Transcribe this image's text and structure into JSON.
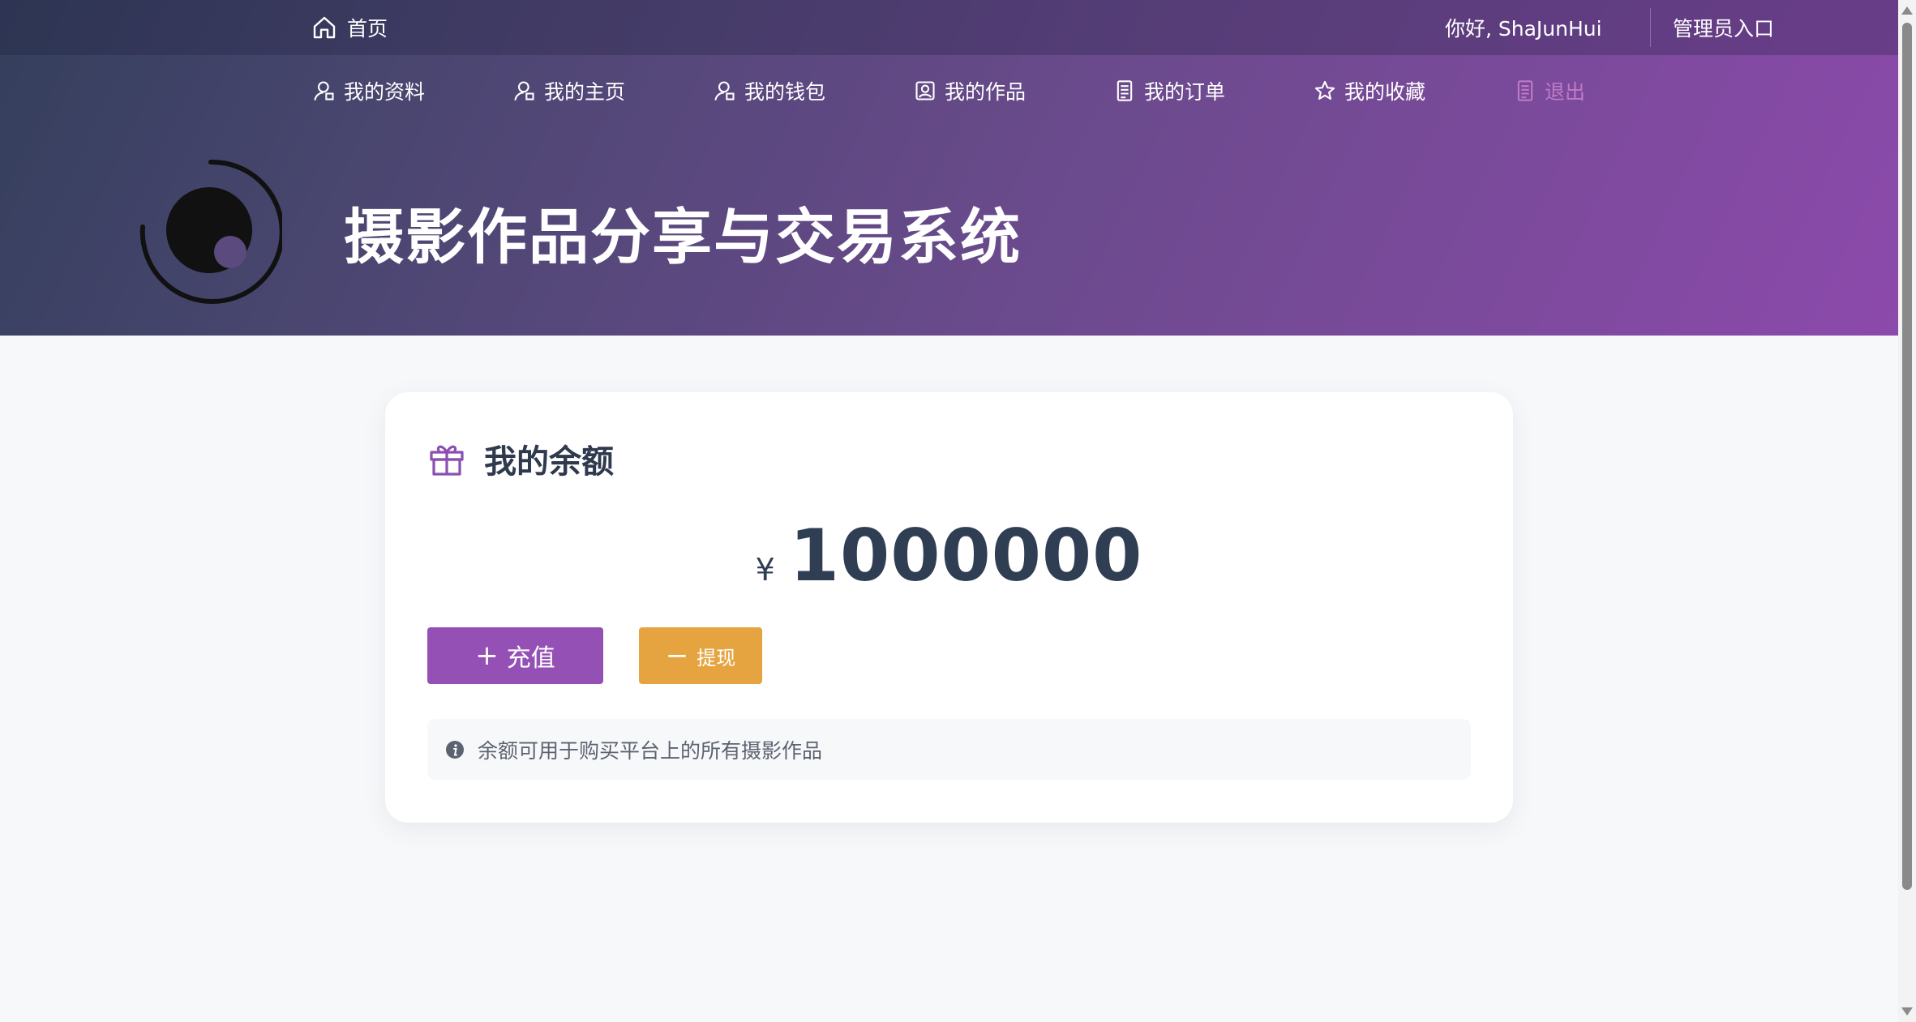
{
  "topbar": {
    "home_label": "首页",
    "home_icon": "home-icon",
    "greeting": "你好, ShaJunHui",
    "admin_label": "管理员入口"
  },
  "nav": {
    "items": [
      {
        "label": "我的资料",
        "icon": "user-icon"
      },
      {
        "label": "我的主页",
        "icon": "user-icon"
      },
      {
        "label": "我的钱包",
        "icon": "user-icon"
      },
      {
        "label": "我的作品",
        "icon": "portrait-icon"
      },
      {
        "label": "我的订单",
        "icon": "document-icon"
      },
      {
        "label": "我的收藏",
        "icon": "star-icon"
      },
      {
        "label": "退出",
        "icon": "document-icon"
      }
    ]
  },
  "site": {
    "title": "摄影作品分享与交易系统",
    "logo_icon": "eclipse-logo"
  },
  "wallet": {
    "title": "我的余额",
    "title_icon": "gift-icon",
    "currency_symbol": "¥",
    "balance": "1000000",
    "recharge_label": "充值",
    "recharge_icon": "plus-icon",
    "withdraw_label": "提现",
    "withdraw_icon": "minus-icon",
    "notice": "余额可用于购买平台上的所有摄影作品",
    "notice_icon": "info-icon"
  },
  "colors": {
    "header_gradient_start": "#343f5c",
    "header_gradient_end": "#8c4aab",
    "recharge_button": "#9550b5",
    "withdraw_button": "#e5a440",
    "logout_text": "#d58ad6",
    "page_background": "#f7f8fa"
  }
}
